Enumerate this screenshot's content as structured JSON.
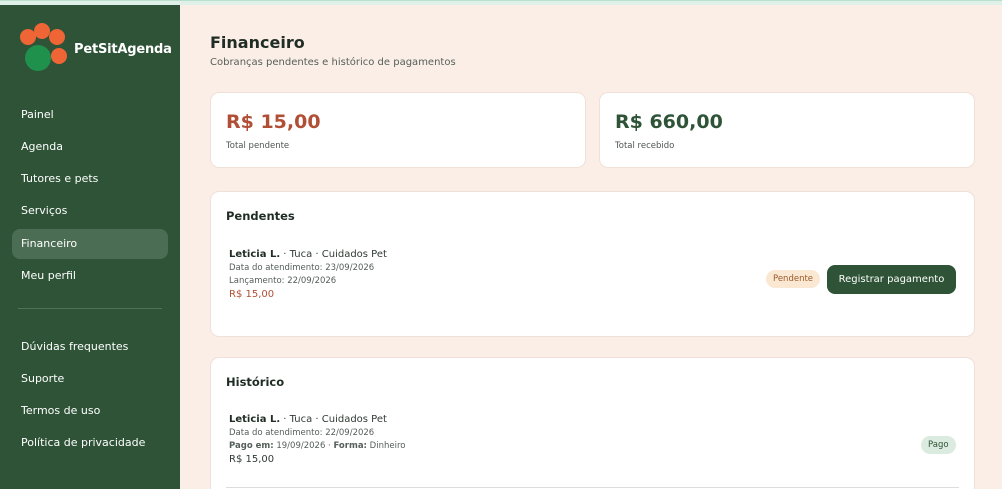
{
  "app": {
    "name": "PetSitAgenda"
  },
  "colors": {
    "sidebar": "#2e5337",
    "accent_pending": "#b14f36",
    "accent_received": "#2e5337",
    "background": "#fbeee6"
  },
  "sidebar": {
    "items": [
      {
        "label": "Painel"
      },
      {
        "label": "Agenda"
      },
      {
        "label": "Tutores e pets"
      },
      {
        "label": "Serviços"
      },
      {
        "label": "Financeiro"
      },
      {
        "label": "Meu perfil"
      }
    ],
    "secondary": [
      {
        "label": "Dúvidas frequentes"
      },
      {
        "label": "Suporte"
      },
      {
        "label": "Termos de uso"
      },
      {
        "label": "Política de privacidade"
      }
    ]
  },
  "page": {
    "title": "Financeiro",
    "subtitle": "Cobranças pendentes e histórico de pagamentos"
  },
  "summary": {
    "pending": {
      "value": "R$ 15,00",
      "label": "Total pendente"
    },
    "received": {
      "value": "R$ 660,00",
      "label": "Total recebido"
    }
  },
  "pending_section": {
    "title": "Pendentes",
    "entries": [
      {
        "client": "Leticia L.",
        "details": " · Tuca · Cuidados Pet",
        "service_date": "Data do atendimento: 23/09/2026",
        "entry_date": "Lançamento: 22/09/2026",
        "amount": "R$ 15,00",
        "status": "Pendente",
        "action": "Registrar pagamento"
      }
    ]
  },
  "history_section": {
    "title": "Histórico",
    "entries": [
      {
        "client": "Leticia L.",
        "details": " · Tuca · Cuidados Pet",
        "service_date": "Data do atendimento: 22/09/2026",
        "paid_label": "Pago em:",
        "paid_date": " 19/09/2026 · ",
        "method_label": "Forma:",
        "method": " Dinheiro",
        "amount": "R$ 15,00",
        "status": "Pago"
      }
    ]
  }
}
